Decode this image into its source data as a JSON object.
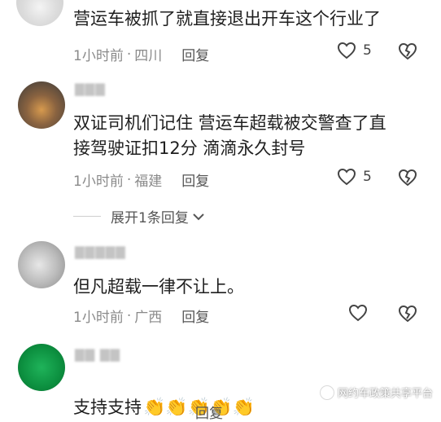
{
  "comments": [
    {
      "text": "营运车被抓了就直接退出开车这个行业了",
      "time": "1小时前",
      "location": "四川",
      "reply_label": "回复",
      "likes": "5"
    },
    {
      "text": "双证司机们记住  营运车超载被交警查了直\n接驾驶证扣12分  滴滴永久封号",
      "time": "1小时前",
      "location": "福建",
      "reply_label": "回复",
      "likes": "5",
      "expand_label": "展开1条回复"
    },
    {
      "text": "但凡超载一律不让上。",
      "time": "1小时前",
      "location": "广西",
      "reply_label": "回复",
      "likes": ""
    },
    {
      "text": "支持支持",
      "emoji": "👏👏👏👏👏",
      "reply_label": "回复"
    }
  ],
  "separator": "·",
  "watermark": "网约车政策共享平台",
  "colors": {
    "meta": "#8a8a8a",
    "body": "#1f1f1f",
    "icon": "#444444"
  },
  "icons": [
    "heart-outline-icon",
    "broken-heart-icon",
    "chevron-down-icon",
    "clapping-hands-emoji"
  ]
}
